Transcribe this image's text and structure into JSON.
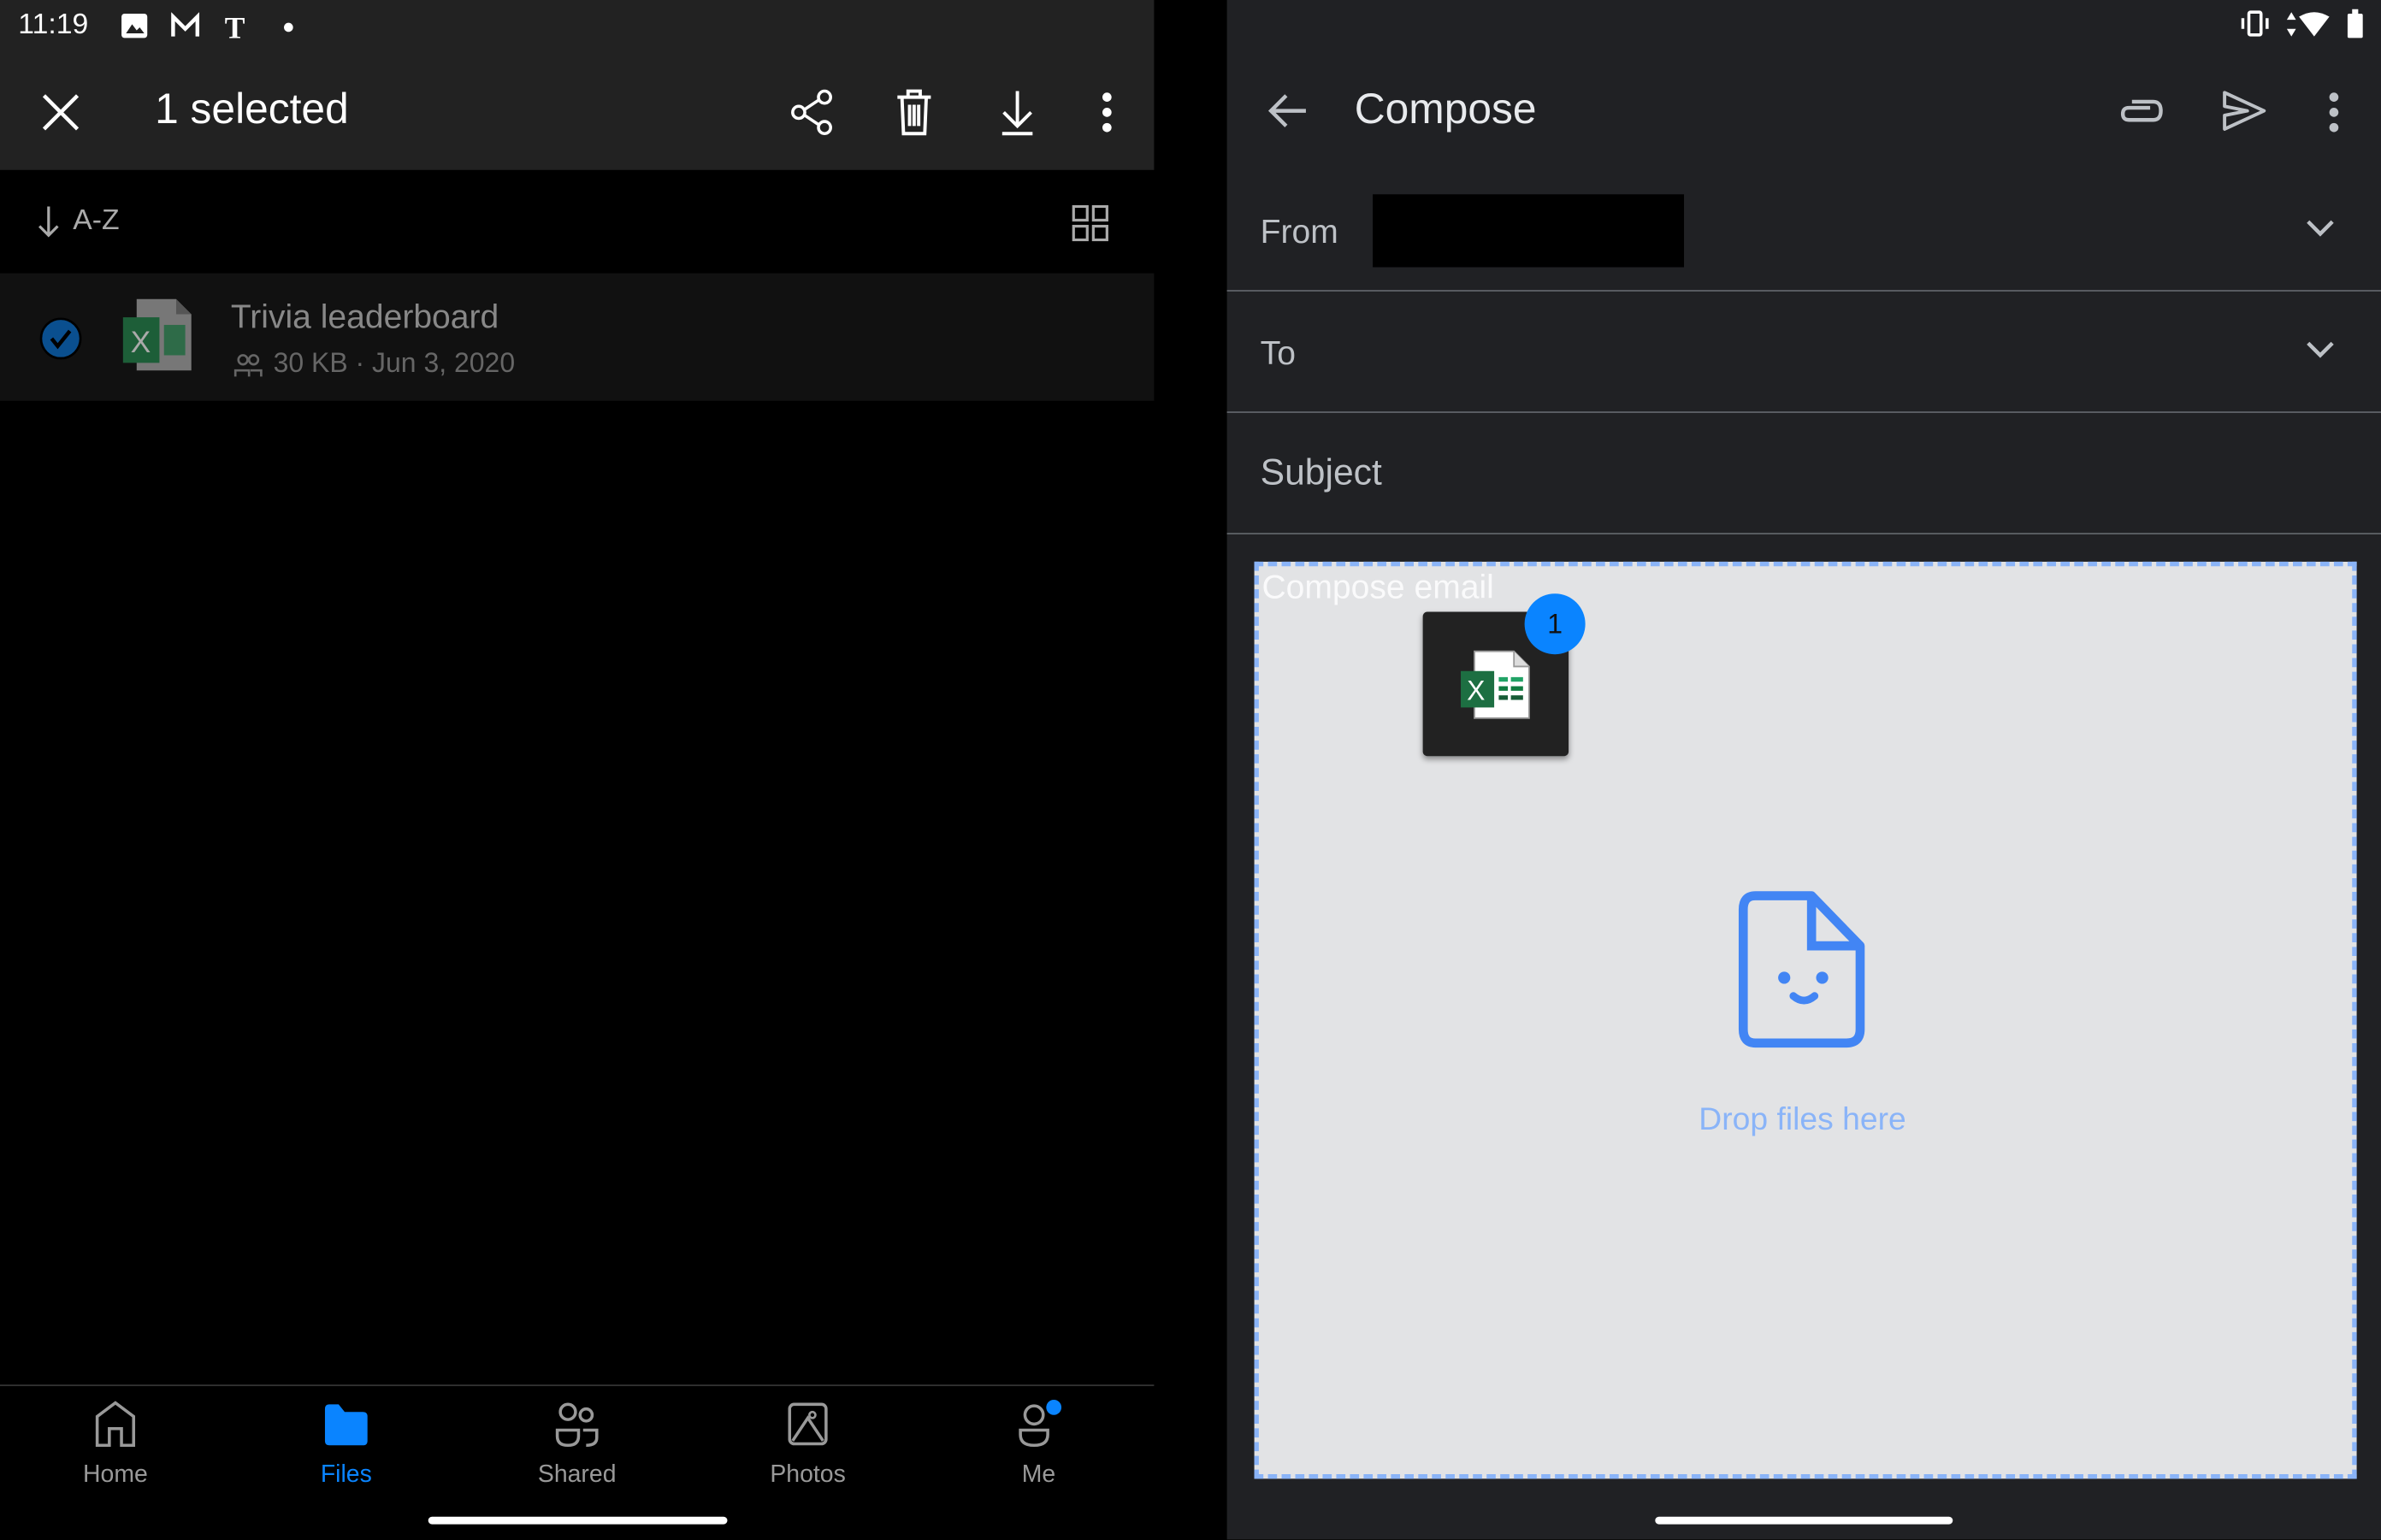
{
  "status_bar": {
    "time": "11:19"
  },
  "files_app": {
    "selection_title": "1 selected",
    "sort_label": "A-Z",
    "files": [
      {
        "name": "Trivia leaderboard",
        "meta": "30 KB · Jun 3, 2020",
        "selected": true
      }
    ],
    "nav": [
      {
        "label": "Home",
        "icon": "home-icon"
      },
      {
        "label": "Files",
        "icon": "folder-icon",
        "active": true
      },
      {
        "label": "Shared",
        "icon": "shared-icon"
      },
      {
        "label": "Photos",
        "icon": "photo-icon"
      },
      {
        "label": "Me",
        "icon": "person-icon",
        "notification": true
      }
    ]
  },
  "compose": {
    "title": "Compose",
    "from_label": "From",
    "to_label": "To",
    "subject_placeholder": "Subject",
    "body_placeholder": "Compose email",
    "drag_count": "1",
    "drop_text": "Drop files here"
  },
  "colors": {
    "accent": "#0a84ff",
    "drop_border": "#8ab4f8",
    "drop_icon": "#4285f4",
    "excel": "#1d6f42"
  }
}
